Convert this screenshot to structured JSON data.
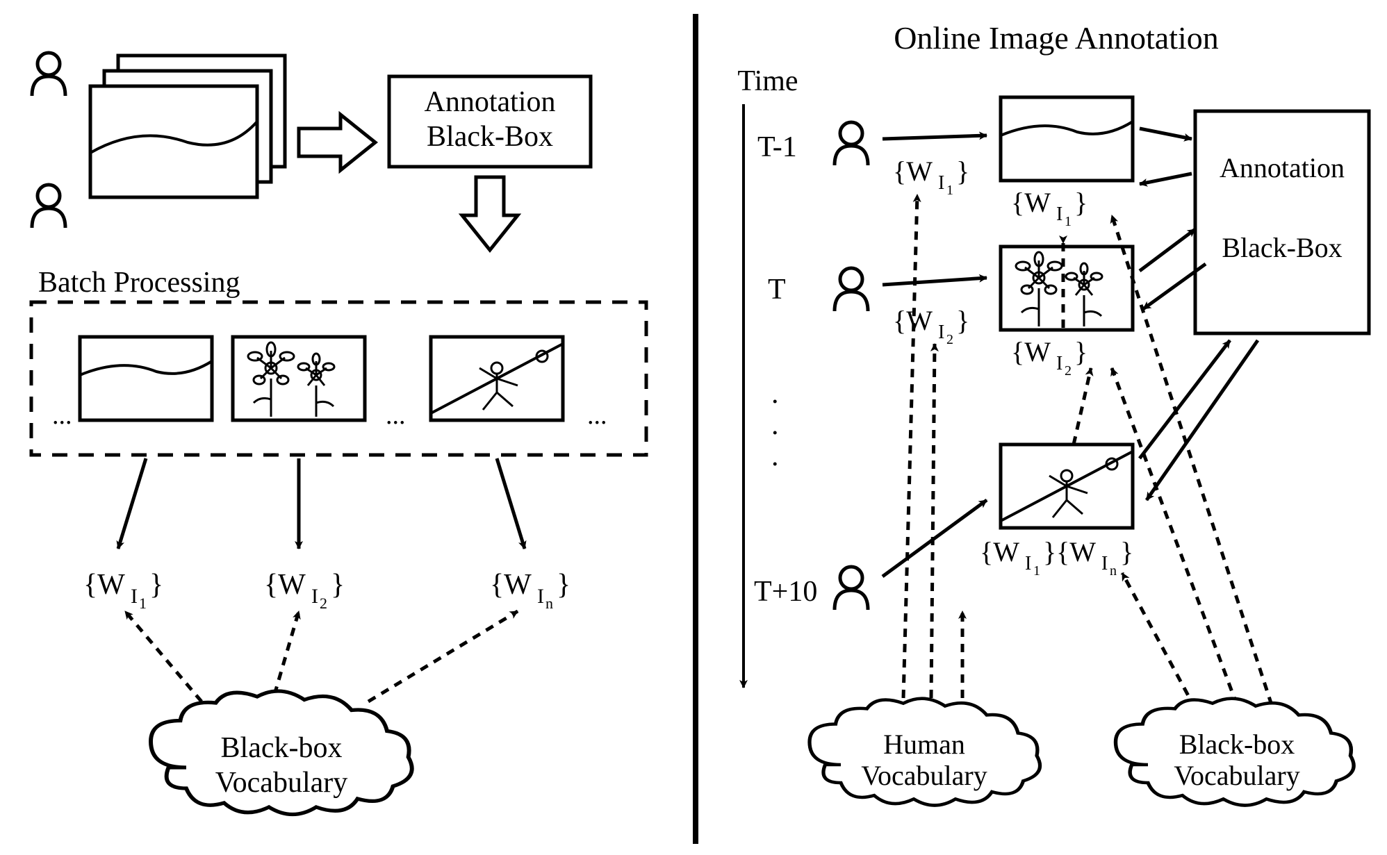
{
  "right": {
    "title": "Online Image Annotation",
    "time_axis_label": "Time",
    "time_marks": [
      "T-1",
      "T",
      "T+10"
    ],
    "time_dots": "...",
    "annotation_box_line1": "Annotation",
    "annotation_box_line2": "Black-Box",
    "labels_under_images": [
      "{W_{I_1}}",
      "{W_{I_2}}",
      "{W_{I_1}}{W_{I_n}}"
    ],
    "arrow_labels": [
      "{W_{I_1}}",
      "{W_{I_2}}"
    ],
    "cloud_human_line1": "Human",
    "cloud_human_line2": "Vocabulary",
    "cloud_blackbox_line1": "Black-box",
    "cloud_blackbox_line2": "Vocabulary"
  },
  "left": {
    "annotation_box_line1": "Annotation",
    "annotation_box_line2": "Black-Box",
    "batch_label": "Batch Processing",
    "ellipsis": "...",
    "output_labels": [
      "{W_{I_1}}",
      "{W_{I_2}}",
      "{W_{I_n}}"
    ],
    "cloud_line1": "Black-box",
    "cloud_line2": "Vocabulary"
  }
}
